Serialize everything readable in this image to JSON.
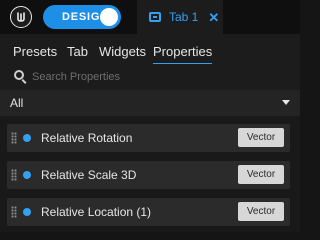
{
  "header": {
    "mode_label": "DESIGN",
    "tab_title": "Tab 1",
    "tab_close": "✕"
  },
  "subtabs": [
    {
      "label": "Presets",
      "active": false
    },
    {
      "label": "Tab",
      "active": false
    },
    {
      "label": "Widgets",
      "active": false
    },
    {
      "label": "Properties",
      "active": true
    }
  ],
  "search": {
    "placeholder": "Search Properties",
    "value": ""
  },
  "filter": {
    "selected": "All"
  },
  "properties": [
    {
      "label": "Relative Rotation",
      "type": "Vector"
    },
    {
      "label": "Relative Scale 3D",
      "type": "Vector"
    },
    {
      "label": "Relative Location (1)",
      "type": "Vector"
    }
  ],
  "colors": {
    "accent": "#33a1f2",
    "toggle": "#1e8fe6",
    "background": "#151515",
    "row": "#2b2b2b",
    "button": "#d7d7d7"
  },
  "icons": {
    "logo": "unreal-logo-icon",
    "tab": "screen-icon",
    "close": "close-icon",
    "search": "search-icon",
    "dropdown": "chevron-down-icon",
    "drag": "drag-handle-icon"
  }
}
